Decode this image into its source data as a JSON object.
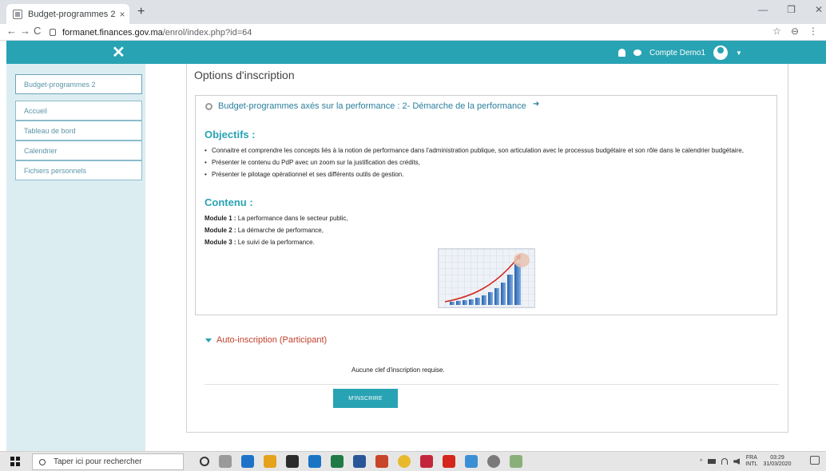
{
  "browser": {
    "tab_title": "Budget-programmes 2",
    "tab_close": "×",
    "new_tab": "+",
    "url_host": "formanet.finances.gov.ma",
    "url_path": "/enrol/index.php?id=64",
    "back": "←",
    "forward": "→",
    "reload": "C",
    "star": "☆",
    "account": "⊖",
    "menu": "⋮",
    "minimize": "—",
    "restore": "❐",
    "close_window": "✕"
  },
  "header": {
    "close_symbol": "✕",
    "user_name": "Compte Demo1",
    "caret": "▼"
  },
  "drawer": {
    "course_item": "Budget-programmes 2",
    "items": [
      "Accueil",
      "Tableau de bord",
      "Calendrier",
      "Fichiers personnels"
    ]
  },
  "main": {
    "page_title": "Options d'inscription",
    "course_name": "Budget-programmes axés sur la performance : 2- Démarche de la performance",
    "enter_symbol": "➜",
    "objectives_heading": "Objectifs :",
    "objectives": [
      "Connaitre et comprendre les concepts liés à la notion de performance dans l'administration publique, son articulation avec le processus budgétaire et son rôle dans le calendrier budgétaire,",
      "Présenter le contenu du PdP avec un zoom sur la justification des crédits,",
      "Présenter le pilotage opérationnel et ses différents outils de gestion."
    ],
    "content_heading": "Contenu :",
    "modules": [
      {
        "label": "Module 1 :",
        "text": "La performance dans le secteur public,"
      },
      {
        "label": "Module 2 :",
        "text": "La démarche de performance,"
      },
      {
        "label": "Module 3 :",
        "text": "Le suivi de la performance."
      }
    ],
    "enrol_section": "Auto-inscription (Participant)",
    "no_key_text": "Aucune clef d'inscription requise.",
    "enrol_button": "M'INSCRIRE"
  },
  "taskbar": {
    "search_placeholder": "Taper ici pour rechercher",
    "lang_top": "FRA",
    "lang_bottom": "INTL",
    "time": "03:29",
    "date": "31/03/2020"
  },
  "colors": {
    "accent": "#28a3b3",
    "section_red": "#c2402d",
    "drawer_bg": "#dcedf2"
  }
}
